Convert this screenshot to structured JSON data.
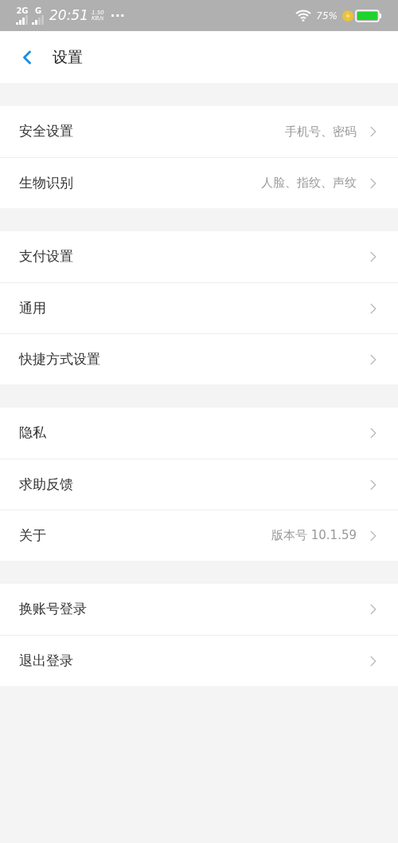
{
  "status_bar": {
    "network": "2G",
    "network_2": "G",
    "time": "20:51",
    "speed": "1.50",
    "speed_unit": "KB/s",
    "more": "···",
    "battery": "75%"
  },
  "header": {
    "title": "设置"
  },
  "groups": [
    {
      "items": [
        {
          "label": "安全设置",
          "value": "手机号、密码"
        },
        {
          "label": "生物识别",
          "value": "人脸、指纹、声纹"
        }
      ]
    },
    {
      "items": [
        {
          "label": "支付设置"
        },
        {
          "label": "通用"
        },
        {
          "label": "快捷方式设置"
        }
      ]
    },
    {
      "items": [
        {
          "label": "隐私"
        },
        {
          "label": "求助反馈"
        },
        {
          "label": "关于",
          "value": "版本号 10.1.59"
        }
      ]
    },
    {
      "items": [
        {
          "label": "换账号登录"
        },
        {
          "label": "退出登录"
        }
      ]
    }
  ]
}
